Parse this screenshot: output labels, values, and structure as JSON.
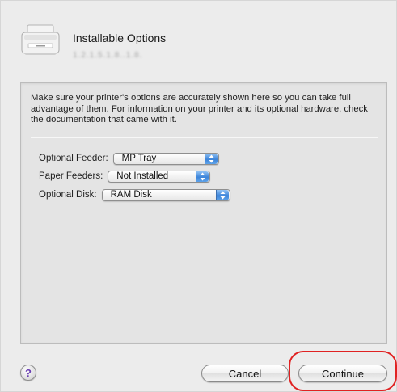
{
  "dialog": {
    "title": "Installable Options",
    "subtitle": "1.2.1.5.1.8..1.8."
  },
  "panel": {
    "description": "Make sure your printer's options are accurately shown here so you can take full advantage of them.  For information on your printer and its optional hardware, check the documentation that came with it.",
    "options": [
      {
        "label": "Optional Feeder:",
        "value": "MP Tray"
      },
      {
        "label": "Paper Feeders:",
        "value": "Not Installed"
      },
      {
        "label": "Optional Disk:",
        "value": "RAM Disk"
      }
    ]
  },
  "footer": {
    "help_symbol": "?",
    "cancel_label": "Cancel",
    "continue_label": "Continue"
  },
  "colors": {
    "popup_arrow": "#3c84d9",
    "highlight_ring": "#e02222",
    "help_glyph": "#6a3fb2"
  },
  "icons": {
    "printer": "printer-icon",
    "popup_arrows": "up-down-arrows-icon"
  }
}
